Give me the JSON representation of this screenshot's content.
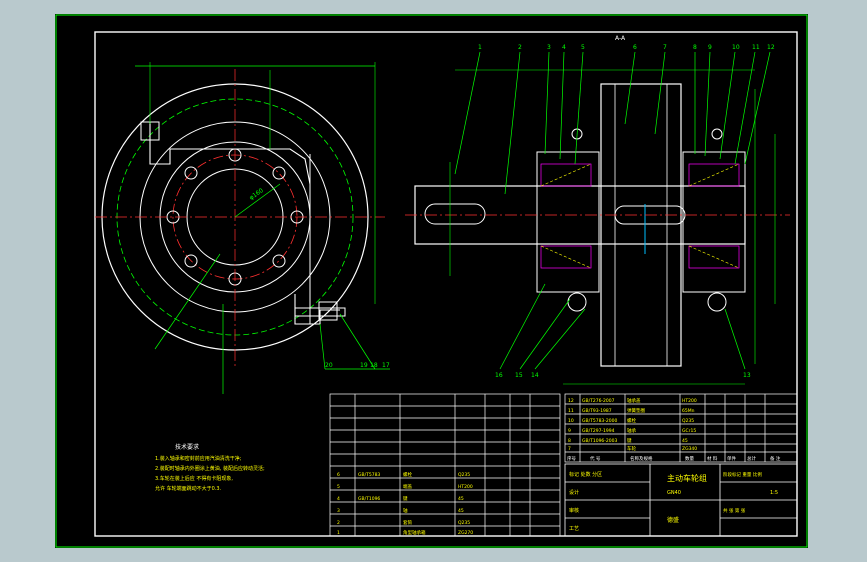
{
  "drawing": {
    "title_block": {
      "name": "主动车轮组",
      "code": "GN40",
      "company": "德盛",
      "row_left_1": "标记 处数 分区",
      "row_left_2": "设计",
      "row_left_3": "审核",
      "row_left_4": "工艺",
      "stage_header": "阶段标记 重量 比例",
      "scale": "1:5",
      "sheet": "共 张 第 张"
    },
    "tech_notes": {
      "heading": "技术要求",
      "lines": [
        "1.装入轴承和密封前应用汽油清洗干净;",
        "2.装配时轴承内外圈涂上黄油, 装配后应转动灵活;",
        "3.车轮在装上后应 不得有卡阻现象,",
        "允许 车轮端面跳动不大于0.3."
      ]
    },
    "section_label": "A-A",
    "callout_numbers_top": [
      "1",
      "2",
      "3",
      "4",
      "5",
      "6",
      "7",
      "8",
      "9",
      "10",
      "11",
      "12"
    ],
    "callout_numbers_bottom": [
      "16",
      "15",
      "14",
      "13"
    ],
    "callout_numbers_left": [
      "20",
      "19",
      "18",
      "17"
    ],
    "dim_label": "φ160",
    "parts_header": [
      "序号",
      "代 号",
      "名称及规格",
      "数量",
      "材 料",
      "单件",
      "总计",
      "备 注"
    ],
    "part_rows_right": [
      {
        "no": "12",
        "code": "GB/T276-2007",
        "name": "轴承盖",
        "mat": "HT200"
      },
      {
        "no": "11",
        "code": "GB/T93-1987",
        "name": "弹簧垫圈",
        "mat": "65Mn"
      },
      {
        "no": "10",
        "code": "GB/T5783-2000",
        "name": "螺栓",
        "mat": "Q235"
      },
      {
        "no": "9",
        "code": "GB/T297-1994",
        "name": "轴承",
        "mat": "GCr15"
      },
      {
        "no": "8",
        "code": "GB/T1096-2003",
        "name": "键",
        "mat": "45"
      },
      {
        "no": "7",
        "code": "",
        "name": "车轮",
        "mat": "ZG340"
      }
    ],
    "part_rows_left": [
      {
        "no": "6",
        "code": "GB/T5783",
        "name": "螺栓",
        "mat": "Q235"
      },
      {
        "no": "5",
        "code": "",
        "name": "端盖",
        "mat": "HT200"
      },
      {
        "no": "4",
        "code": "GB/T1096",
        "name": "键",
        "mat": "45"
      },
      {
        "no": "3",
        "code": "",
        "name": "轴",
        "mat": "45"
      },
      {
        "no": "2",
        "code": "",
        "name": "套筒",
        "mat": "Q235"
      },
      {
        "no": "1",
        "code": "",
        "name": "角型轴承箱",
        "mat": "ZG270"
      }
    ],
    "colors": {
      "frame": "#ffffff",
      "outline": "#ffffff",
      "callout": "#00ff00",
      "centerline": "#ff3030",
      "hidden": "#ffff00",
      "accent": "#ff00ff",
      "section": "#00c0ff"
    }
  }
}
